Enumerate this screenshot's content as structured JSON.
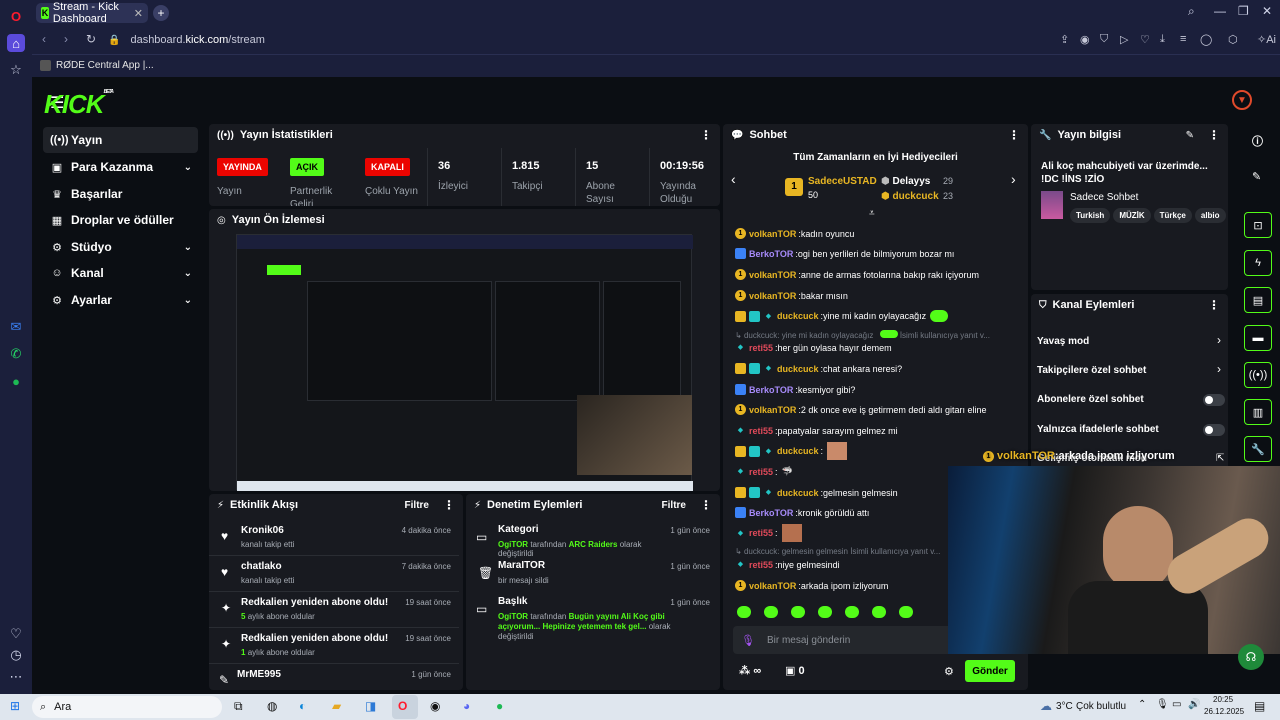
{
  "browser": {
    "tab_title": "Stream - Kick Dashboard",
    "url_prefix": "dashboard.",
    "url_host": "kick.com",
    "url_path": "/stream",
    "bookmark": "RØDE Central App |...",
    "ai_label": "Ai"
  },
  "logo": {
    "text": "KICK",
    "beta": "BETA"
  },
  "sidebar": {
    "items": [
      {
        "label": "Yayın"
      },
      {
        "label": "Para Kazanma"
      },
      {
        "label": "Başarılar"
      },
      {
        "label": "Droplar ve ödüller"
      },
      {
        "label": "Stüdyo"
      },
      {
        "label": "Kanal"
      },
      {
        "label": "Ayarlar"
      }
    ]
  },
  "stats": {
    "title": "Yayın İstatistikleri",
    "live_badge": "YAYINDA",
    "live_label": "Yayın",
    "partner_badge": "AÇIK",
    "partner_label": "Partnerlik Geliri",
    "multi_badge": "KAPALI",
    "multi_label": "Çoklu Yayın",
    "viewers": "36",
    "viewers_label": "İzleyici",
    "followers": "1.815",
    "followers_label": "Takipçi",
    "subs": "15",
    "subs_label": "Abone Sayısı",
    "duration": "00:19:56",
    "duration_label": "Yayında Olduğu"
  },
  "preview": {
    "title": "Yayın Ön İzlemesi"
  },
  "activity": {
    "title": "Etkinlik Akışı",
    "filter": "Filtre",
    "rows": [
      {
        "title": "Kronik06",
        "sub": "kanalı takip etti",
        "time": "4 dakika önce"
      },
      {
        "title": "chatlako",
        "sub": "kanalı takip etti",
        "time": "7 dakika önce"
      },
      {
        "title": "Redkalien yeniden abone oldu!",
        "sub_num": "5",
        "sub": "aylık abone oldular",
        "time": "19 saat önce"
      },
      {
        "title": "Redkalien yeniden abone oldu!",
        "sub_num": "1",
        "sub": "aylık abone oldular",
        "time": "19 saat önce"
      },
      {
        "title": "MrME995",
        "sub": "",
        "time": "1 gün önce"
      }
    ]
  },
  "moderation": {
    "title": "Denetim Eylemleri",
    "filter": "Filtre",
    "rows": [
      {
        "title": "Kategori",
        "user": "OgiTOR",
        "mid": "tarafından",
        "val": "ARC Raiders",
        "end": "olarak değiştirildi",
        "time": "1 gün önce"
      },
      {
        "title": "MaraITOR",
        "sub": "bir mesajı sildi",
        "time": "1 gün önce"
      },
      {
        "title": "Başlık",
        "user": "OgiTOR",
        "mid": "tarafından",
        "val": "Bugün yayını Ali Koç gibi açıyorum... Hepinize yetemem tek gel...",
        "end": "olarak değiştirildi",
        "time": "1 gün önce"
      }
    ]
  },
  "chat": {
    "title": "Sohbet",
    "gifters_title": "Tüm Zamanların en İyi Hediyecileri",
    "g1_name": "SadeceUSTAD",
    "g1_val": "50",
    "g2_name": "Delayys",
    "g2_val": "29",
    "g3_name": "duckcuck",
    "g3_val": "23",
    "messages": [
      {
        "user": "volkanTOR",
        "text": "kadın oyuncu"
      },
      {
        "user": "BerkoTOR",
        "text": "ogi ben yerlileri de bilmiyorum bozar mı"
      },
      {
        "user": "volkanTOR",
        "text": "anne de armas fotolarına bakıp rakı içiyorum"
      },
      {
        "user": "volkanTOR",
        "text": "bakar mısın"
      },
      {
        "user": "duckcuck",
        "text": "yine mi kadın oylayacağız"
      },
      {
        "reply": "duckcuck: yine mi kadın oylayacağız",
        "reply_tail": "İsimli kullanıcıya yanıt v..."
      },
      {
        "user": "reti55",
        "text": "her gün oylasa hayır demem"
      },
      {
        "user": "duckcuck",
        "text": "chat ankara neresi?"
      },
      {
        "user": "BerkoTOR",
        "text": "kesmiyor gibi?"
      },
      {
        "user": "volkanTOR",
        "text": "2 dk once eve iş getirmem dedi aldı gitarı eline"
      },
      {
        "user": "reti55",
        "text": "papatyalar sarayım gelmez mi"
      },
      {
        "user": "duckcuck",
        "text": ""
      },
      {
        "user": "reti55",
        "text": ""
      },
      {
        "user": "duckcuck",
        "text": "gelmesin gelmesin"
      },
      {
        "user": "BerkoTOR",
        "text": "kronik görüldü attı"
      },
      {
        "user": "reti55",
        "text": ""
      },
      {
        "reply": "duckcuck: gelmesin gelmesin İsimli kullanıcıya yanıt v..."
      },
      {
        "user": "reti55",
        "text": "niye gelmesindi"
      },
      {
        "user": "volkanTOR",
        "text": "arkada ipom izliyorum"
      }
    ],
    "input_placeholder": "Bir mesaj gönderin",
    "send": "Gönder",
    "infinity": "∞",
    "gift_count": "0"
  },
  "info": {
    "title": "Yayın bilgisi",
    "stream_title": "Ali koç mahcubiyeti var üzerimde... !DC !İNS !ZİO",
    "category": "Sadece Sohbet",
    "tags": [
      "Turkish",
      "MÜZİK",
      "Türkçe",
      "albio"
    ]
  },
  "actions": {
    "title": "Kanal Eylemleri",
    "rows": [
      {
        "label": "Yavaş mod"
      },
      {
        "label": "Takipçilere özel sohbet"
      },
      {
        "label": "Abonelere özel sohbet"
      },
      {
        "label": "Yalnızca ifadelerle sohbet"
      },
      {
        "label": "Gelişmiş otomatik mod"
      }
    ]
  },
  "overlay": {
    "user": "volkanTOR",
    "text": "arkada ipom izliyorum"
  },
  "taskbar": {
    "search": "Ara",
    "weather": "3°C",
    "weather_desc": "Çok bulutlu",
    "time": "20:25",
    "date": "26.12.2025"
  },
  "colors": {
    "accent": "#53fc18",
    "panel": "#181a20",
    "bg": "#0b0e13"
  }
}
